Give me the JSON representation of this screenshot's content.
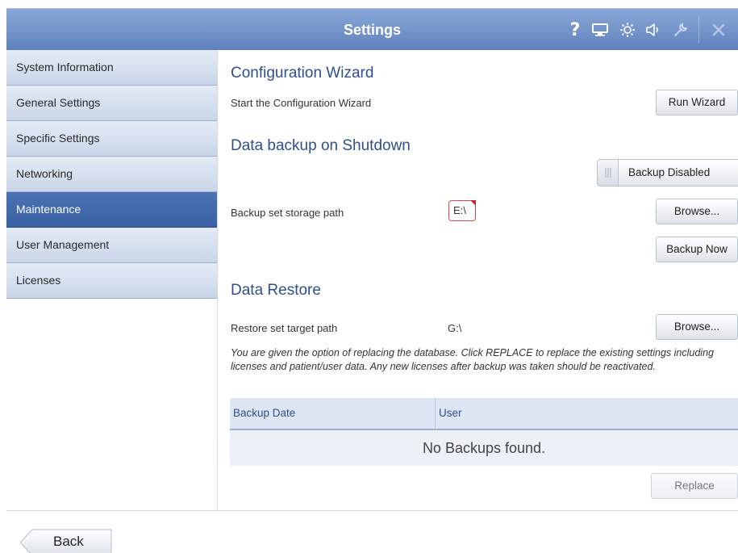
{
  "header": {
    "title": "Settings",
    "icons": [
      "help-icon",
      "display-icon",
      "brightness-icon",
      "volume-icon",
      "wrench-icon",
      "close-icon"
    ],
    "help_glyph": "?",
    "accent_color": "#5f81bd"
  },
  "sidebar": {
    "items": [
      {
        "label": "System Information"
      },
      {
        "label": "General Settings"
      },
      {
        "label": "Specific Settings"
      },
      {
        "label": "Networking"
      },
      {
        "label": "Maintenance",
        "active": true
      },
      {
        "label": "User Management"
      },
      {
        "label": "Licenses"
      }
    ],
    "active_color": "#3f67a9"
  },
  "wizard": {
    "heading": "Configuration Wizard",
    "description": "Start the Configuration Wizard",
    "button_label": "Run Wizard"
  },
  "backup": {
    "heading": "Data backup on Shutdown",
    "toggle_label": "Backup Disabled",
    "path_label": "Backup set storage path",
    "path_value": "E:\\",
    "browse_label": "Browse...",
    "backup_now_label": "Backup Now"
  },
  "restore": {
    "heading": "Data Restore",
    "path_label": "Restore set target path",
    "path_value": "G:\\",
    "browse_label": "Browse...",
    "note": "You are given the option of replacing the database. Click REPLACE to replace the existing settings including licenses and patient/user data. Any new licenses after backup was taken should be reactivated.",
    "table": {
      "columns": [
        "Backup Date",
        "User"
      ],
      "empty_text": "No Backups found."
    },
    "replace_label": "Replace"
  },
  "footer": {
    "back_label": "Back"
  }
}
